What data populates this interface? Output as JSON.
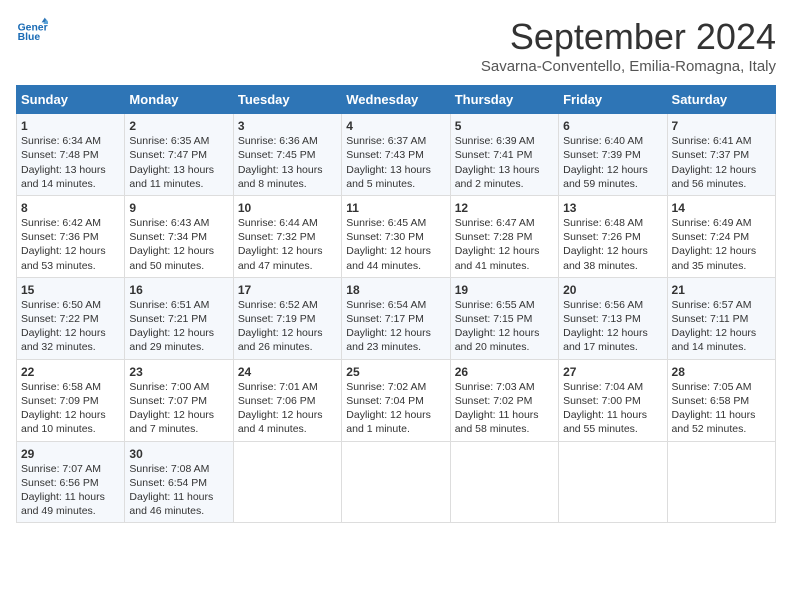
{
  "logo": {
    "line1": "General",
    "line2": "Blue"
  },
  "title": "September 2024",
  "subtitle": "Savarna-Conventello, Emilia-Romagna, Italy",
  "days_header": [
    "Sunday",
    "Monday",
    "Tuesday",
    "Wednesday",
    "Thursday",
    "Friday",
    "Saturday"
  ],
  "weeks": [
    [
      {
        "num": "1",
        "lines": [
          "Sunrise: 6:34 AM",
          "Sunset: 7:48 PM",
          "Daylight: 13 hours",
          "and 14 minutes."
        ]
      },
      {
        "num": "2",
        "lines": [
          "Sunrise: 6:35 AM",
          "Sunset: 7:47 PM",
          "Daylight: 13 hours",
          "and 11 minutes."
        ]
      },
      {
        "num": "3",
        "lines": [
          "Sunrise: 6:36 AM",
          "Sunset: 7:45 PM",
          "Daylight: 13 hours",
          "and 8 minutes."
        ]
      },
      {
        "num": "4",
        "lines": [
          "Sunrise: 6:37 AM",
          "Sunset: 7:43 PM",
          "Daylight: 13 hours",
          "and 5 minutes."
        ]
      },
      {
        "num": "5",
        "lines": [
          "Sunrise: 6:39 AM",
          "Sunset: 7:41 PM",
          "Daylight: 13 hours",
          "and 2 minutes."
        ]
      },
      {
        "num": "6",
        "lines": [
          "Sunrise: 6:40 AM",
          "Sunset: 7:39 PM",
          "Daylight: 12 hours",
          "and 59 minutes."
        ]
      },
      {
        "num": "7",
        "lines": [
          "Sunrise: 6:41 AM",
          "Sunset: 7:37 PM",
          "Daylight: 12 hours",
          "and 56 minutes."
        ]
      }
    ],
    [
      {
        "num": "8",
        "lines": [
          "Sunrise: 6:42 AM",
          "Sunset: 7:36 PM",
          "Daylight: 12 hours",
          "and 53 minutes."
        ]
      },
      {
        "num": "9",
        "lines": [
          "Sunrise: 6:43 AM",
          "Sunset: 7:34 PM",
          "Daylight: 12 hours",
          "and 50 minutes."
        ]
      },
      {
        "num": "10",
        "lines": [
          "Sunrise: 6:44 AM",
          "Sunset: 7:32 PM",
          "Daylight: 12 hours",
          "and 47 minutes."
        ]
      },
      {
        "num": "11",
        "lines": [
          "Sunrise: 6:45 AM",
          "Sunset: 7:30 PM",
          "Daylight: 12 hours",
          "and 44 minutes."
        ]
      },
      {
        "num": "12",
        "lines": [
          "Sunrise: 6:47 AM",
          "Sunset: 7:28 PM",
          "Daylight: 12 hours",
          "and 41 minutes."
        ]
      },
      {
        "num": "13",
        "lines": [
          "Sunrise: 6:48 AM",
          "Sunset: 7:26 PM",
          "Daylight: 12 hours",
          "and 38 minutes."
        ]
      },
      {
        "num": "14",
        "lines": [
          "Sunrise: 6:49 AM",
          "Sunset: 7:24 PM",
          "Daylight: 12 hours",
          "and 35 minutes."
        ]
      }
    ],
    [
      {
        "num": "15",
        "lines": [
          "Sunrise: 6:50 AM",
          "Sunset: 7:22 PM",
          "Daylight: 12 hours",
          "and 32 minutes."
        ]
      },
      {
        "num": "16",
        "lines": [
          "Sunrise: 6:51 AM",
          "Sunset: 7:21 PM",
          "Daylight: 12 hours",
          "and 29 minutes."
        ]
      },
      {
        "num": "17",
        "lines": [
          "Sunrise: 6:52 AM",
          "Sunset: 7:19 PM",
          "Daylight: 12 hours",
          "and 26 minutes."
        ]
      },
      {
        "num": "18",
        "lines": [
          "Sunrise: 6:54 AM",
          "Sunset: 7:17 PM",
          "Daylight: 12 hours",
          "and 23 minutes."
        ]
      },
      {
        "num": "19",
        "lines": [
          "Sunrise: 6:55 AM",
          "Sunset: 7:15 PM",
          "Daylight: 12 hours",
          "and 20 minutes."
        ]
      },
      {
        "num": "20",
        "lines": [
          "Sunrise: 6:56 AM",
          "Sunset: 7:13 PM",
          "Daylight: 12 hours",
          "and 17 minutes."
        ]
      },
      {
        "num": "21",
        "lines": [
          "Sunrise: 6:57 AM",
          "Sunset: 7:11 PM",
          "Daylight: 12 hours",
          "and 14 minutes."
        ]
      }
    ],
    [
      {
        "num": "22",
        "lines": [
          "Sunrise: 6:58 AM",
          "Sunset: 7:09 PM",
          "Daylight: 12 hours",
          "and 10 minutes."
        ]
      },
      {
        "num": "23",
        "lines": [
          "Sunrise: 7:00 AM",
          "Sunset: 7:07 PM",
          "Daylight: 12 hours",
          "and 7 minutes."
        ]
      },
      {
        "num": "24",
        "lines": [
          "Sunrise: 7:01 AM",
          "Sunset: 7:06 PM",
          "Daylight: 12 hours",
          "and 4 minutes."
        ]
      },
      {
        "num": "25",
        "lines": [
          "Sunrise: 7:02 AM",
          "Sunset: 7:04 PM",
          "Daylight: 12 hours",
          "and 1 minute."
        ]
      },
      {
        "num": "26",
        "lines": [
          "Sunrise: 7:03 AM",
          "Sunset: 7:02 PM",
          "Daylight: 11 hours",
          "and 58 minutes."
        ]
      },
      {
        "num": "27",
        "lines": [
          "Sunrise: 7:04 AM",
          "Sunset: 7:00 PM",
          "Daylight: 11 hours",
          "and 55 minutes."
        ]
      },
      {
        "num": "28",
        "lines": [
          "Sunrise: 7:05 AM",
          "Sunset: 6:58 PM",
          "Daylight: 11 hours",
          "and 52 minutes."
        ]
      }
    ],
    [
      {
        "num": "29",
        "lines": [
          "Sunrise: 7:07 AM",
          "Sunset: 6:56 PM",
          "Daylight: 11 hours",
          "and 49 minutes."
        ]
      },
      {
        "num": "30",
        "lines": [
          "Sunrise: 7:08 AM",
          "Sunset: 6:54 PM",
          "Daylight: 11 hours",
          "and 46 minutes."
        ]
      },
      null,
      null,
      null,
      null,
      null
    ]
  ]
}
